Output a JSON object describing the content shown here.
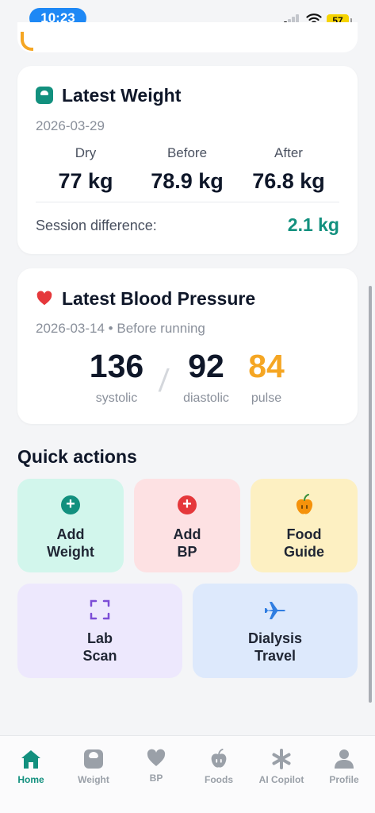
{
  "status_bar": {
    "time": "10:23",
    "battery": "57"
  },
  "weight_card": {
    "title": "Latest Weight",
    "date": "2026-03-29",
    "columns": [
      {
        "label": "Dry",
        "value": "77 kg"
      },
      {
        "label": "Before",
        "value": "78.9 kg"
      },
      {
        "label": "After",
        "value": "76.8 kg"
      }
    ],
    "difference_label": "Session difference:",
    "difference_value": "2.1 kg"
  },
  "bp_card": {
    "title": "Latest Blood Pressure",
    "date_line": "2026-03-14 • Before running",
    "systolic": {
      "value": "136",
      "label": "systolic"
    },
    "diastolic": {
      "value": "92",
      "label": "diastolic"
    },
    "pulse": {
      "value": "84",
      "label": "pulse"
    }
  },
  "quick_actions": {
    "title": "Quick actions",
    "tiles": [
      {
        "label": "Add\nWeight",
        "icon": "plus-circle-icon",
        "bg": "#d2f6ec",
        "accent": "#12907e"
      },
      {
        "label": "Add\nBP",
        "icon": "plus-circle-icon",
        "bg": "#fde1e3",
        "accent": "#e5383b"
      },
      {
        "label": "Food\nGuide",
        "icon": "apple-icon",
        "bg": "#fdf0c2",
        "accent": "#f5920b"
      },
      {
        "label": "Lab\nScan",
        "icon": "scan-icon",
        "bg": "#ede8fd",
        "accent": "#7c4dd6"
      },
      {
        "label": "Dialysis\nTravel",
        "icon": "airplane-icon",
        "bg": "#dde9fc",
        "accent": "#2f7de1"
      }
    ]
  },
  "tab_bar": {
    "tabs": [
      {
        "label": "Home",
        "icon": "home-icon",
        "active": true
      },
      {
        "label": "Weight",
        "icon": "scale-icon",
        "active": false
      },
      {
        "label": "BP",
        "icon": "heart-icon",
        "active": false
      },
      {
        "label": "Foods",
        "icon": "apple-icon",
        "active": false
      },
      {
        "label": "AI Copilot",
        "icon": "sparkle-icon",
        "active": false
      },
      {
        "label": "Profile",
        "icon": "person-icon",
        "active": false
      }
    ]
  },
  "colors": {
    "brand_teal": "#12907e",
    "heart_red": "#e5383b",
    "pulse_orange": "#f5a623",
    "status_blue": "#1e88f5"
  }
}
